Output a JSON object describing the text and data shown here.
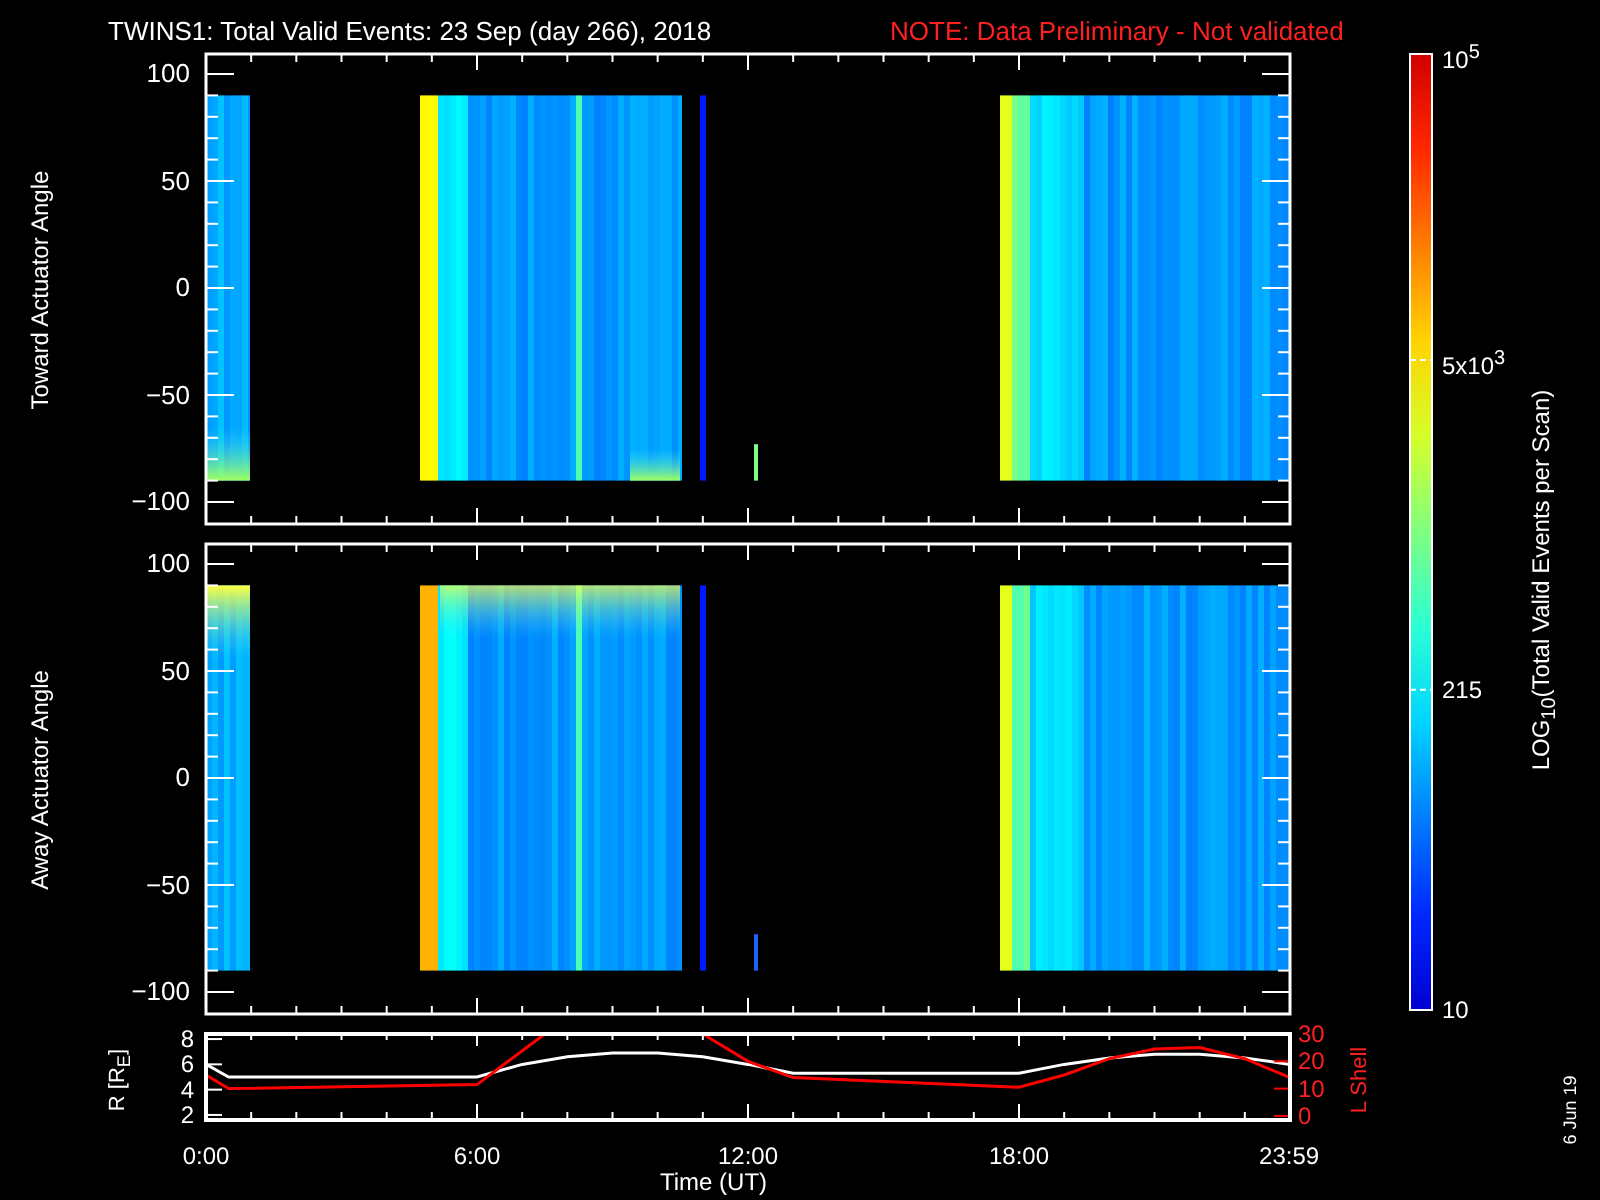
{
  "title": "TWINS1: Total Valid Events: 23 Sep (day 266), 2018",
  "note": "NOTE: Data Preliminary - Not validated",
  "panels": [
    {
      "ylabel": "Toward Actuator Angle",
      "yticks": [
        "100",
        "50",
        "0",
        "−50",
        "−100"
      ]
    },
    {
      "ylabel": "Away Actuator Angle",
      "yticks": [
        "100",
        "50",
        "0",
        "−50",
        "−100"
      ]
    }
  ],
  "colorbar": {
    "label": "LOG$_{10}$(Total Valid Events per Scan)",
    "ticks": [
      "10$^{5}$",
      "5x10$^{3}$",
      "215",
      "10"
    ]
  },
  "orbit": {
    "r_chart": {
      "chart_data": {
        "type": "line",
        "xlabel": "Time (UT)",
        "ylabel": "R [R$_{E}$]",
        "x": [
          0,
          0.5,
          6,
          7,
          8,
          9,
          10,
          11,
          12,
          13,
          18,
          19,
          20,
          21,
          22,
          23,
          24
        ],
        "series": [
          {
            "color": "#ffffff",
            "values": [
              6,
              5,
              5,
              6,
              6.6,
              6.9,
              6.9,
              6.6,
              6,
              5.3,
              5.3,
              6,
              6.5,
              6.8,
              6.8,
              6.5,
              6
            ]
          }
        ],
        "xlim": [
          0,
          24
        ],
        "ylim": [
          1.6,
          8.4
        ],
        "xticks": [
          {
            "value": 0,
            "label": "0:00"
          },
          {
            "value": 6,
            "label": "6:00"
          },
          {
            "value": 12,
            "label": "12:00"
          },
          {
            "value": 18,
            "label": "18:00"
          },
          {
            "value": 23.98,
            "label": "23:59"
          }
        ],
        "yticks": [
          2,
          4,
          6,
          8
        ]
      }
    },
    "l_chart": {
      "chart_data": {
        "type": "line",
        "ylabel": "L Shell",
        "x": [
          0,
          0.5,
          6,
          7.5,
          11,
          12,
          13,
          18,
          19,
          20,
          21,
          22,
          23,
          24
        ],
        "series": [
          {
            "color": "#ff0000",
            "values": [
              15,
              10,
              11.5,
              30,
              30,
              20,
              14,
              10.5,
              15,
              21,
              24.5,
              25,
              21,
              14
            ]
          }
        ],
        "xlim": [
          0,
          24
        ],
        "ylim": [
          -1.5,
          30
        ],
        "yticks": [
          0,
          10,
          20,
          30
        ]
      }
    }
  },
  "stamp": "6 Jun 19"
}
